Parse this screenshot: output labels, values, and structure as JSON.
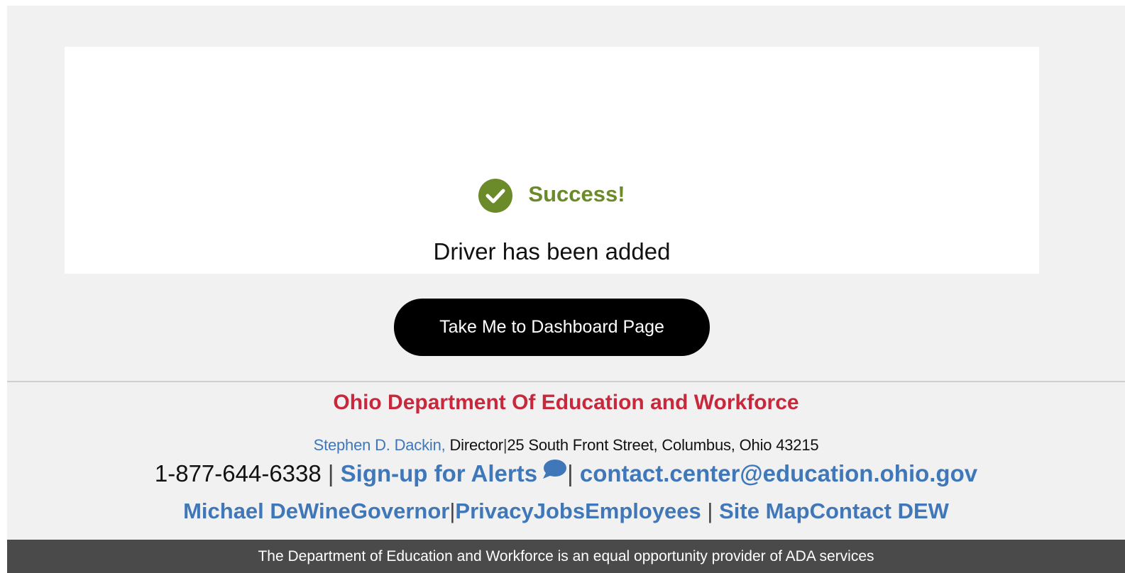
{
  "success": {
    "icon": "check-circle-icon",
    "title": "Success!",
    "message": "Driver has been added",
    "accent_color": "#6b8a2a"
  },
  "actions": {
    "dashboard_button_label": "Take Me to Dashboard Page"
  },
  "footer": {
    "org_name": "Ohio Department Of Education and Workforce",
    "director_name": "Stephen D. Dackin,",
    "director_title": " Director",
    "address": "25 South Front Street, Columbus, Ohio 43215",
    "phone": "1-877-644-6338",
    "alerts_link": "Sign-up for Alerts",
    "alerts_icon": "chat-bubble-icon",
    "email_link": "contact.center@education.ohio.gov",
    "governor_link": "Michael DeWine",
    "governor_label": "Governor",
    "privacy_link": "Privacy",
    "jobs_link": "Jobs",
    "employees_link": "Employees",
    "sitemap_link": "Site Map",
    "contact_link": "Contact DEW",
    "separator": "|",
    "org_color": "#c8283c",
    "link_color": "#3f77b8"
  },
  "bottom_bar": {
    "notice": "The Department of Education and Workforce is an equal opportunity provider of ADA services"
  }
}
